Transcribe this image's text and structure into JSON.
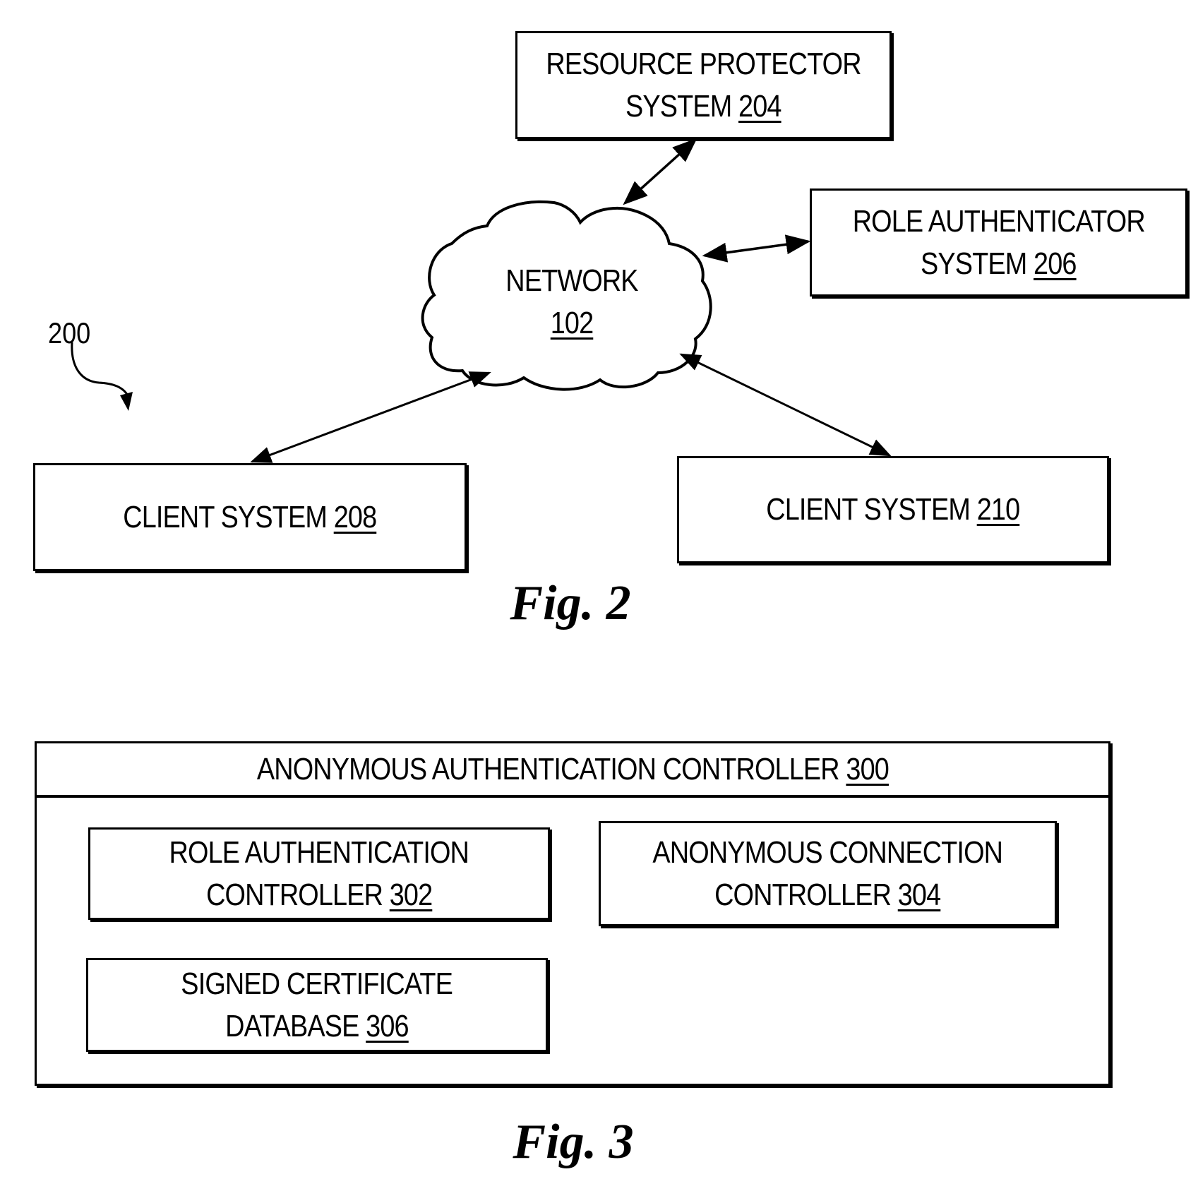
{
  "figure2": {
    "ref_label": "200",
    "network": {
      "name": "NETWORK",
      "ref": "102"
    },
    "resource_protector": {
      "line1": "RESOURCE PROTECTOR",
      "line2": "SYSTEM",
      "ref": "204"
    },
    "role_authenticator": {
      "line1": "ROLE AUTHENTICATOR",
      "line2": "SYSTEM",
      "ref": "206"
    },
    "client_a": {
      "line1": "CLIENT SYSTEM",
      "ref": "208"
    },
    "client_b": {
      "line1": "CLIENT SYSTEM",
      "ref": "210"
    },
    "caption": "Fig. 2",
    "connections": [
      {
        "from": "network",
        "to": "resource_protector",
        "type": "bidirectional"
      },
      {
        "from": "network",
        "to": "role_authenticator",
        "type": "bidirectional"
      },
      {
        "from": "network",
        "to": "client_a",
        "type": "bidirectional"
      },
      {
        "from": "network",
        "to": "client_b",
        "type": "bidirectional"
      }
    ]
  },
  "figure3": {
    "container": {
      "line1": "ANONYMOUS AUTHENTICATION CONTROLLER",
      "ref": "300"
    },
    "role_auth_controller": {
      "line1": "ROLE AUTHENTICATION",
      "line2": "CONTROLLER",
      "ref": "302"
    },
    "anon_conn_controller": {
      "line1": "ANONYMOUS CONNECTION",
      "line2": "CONTROLLER",
      "ref": "304"
    },
    "signed_cert_db": {
      "line1": "SIGNED CERTIFICATE",
      "line2": "DATABASE",
      "ref": "306"
    },
    "caption": "Fig. 3"
  }
}
